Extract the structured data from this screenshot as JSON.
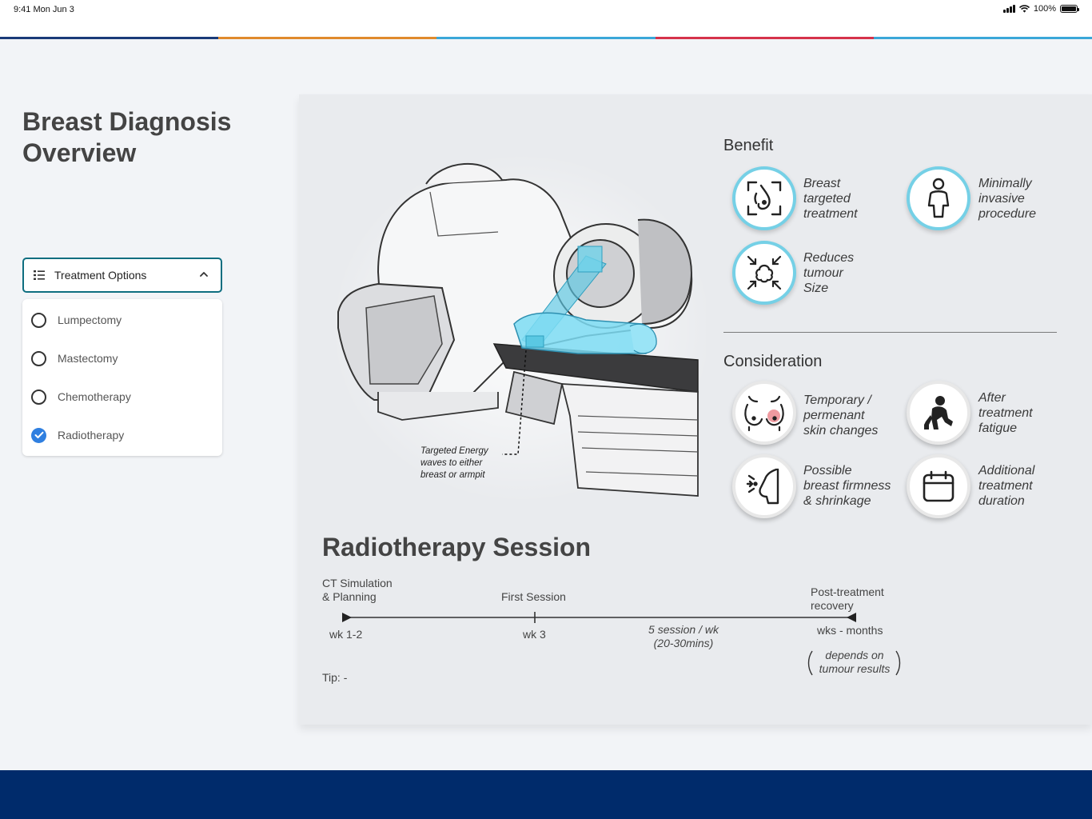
{
  "status_bar": {
    "time": "9:41  Mon Jun 3",
    "battery": "100%"
  },
  "colors": {
    "accent_bar": [
      "#1a3a78",
      "#e08a2c",
      "#3aa7d8",
      "#d6334b",
      "#3aa7d8"
    ],
    "footer": "#002b6b",
    "benefit_ring": "#75d0e6",
    "check": "#2f7fe0",
    "dropdown_border": "#0e6e80"
  },
  "page": {
    "title_line1": "Breast Diagnosis",
    "title_line2": "Overview"
  },
  "dropdown": {
    "label": "Treatment Options",
    "icon": "list-icon",
    "expanded": true
  },
  "options": [
    {
      "label": "Lumpectomy",
      "checked": false
    },
    {
      "label": "Mastectomy",
      "checked": false
    },
    {
      "label": "Chemotherapy",
      "checked": false
    },
    {
      "label": "Radiotherapy",
      "checked": true
    }
  ],
  "illustration": {
    "caption_line1": "Targeted Energy",
    "caption_line2": "waves to either",
    "caption_line3": "breast or armpit"
  },
  "benefit": {
    "title": "Benefit",
    "items": [
      {
        "icon": "breast-target-icon",
        "lines": [
          "Breast",
          "targeted",
          "treatment"
        ]
      },
      {
        "icon": "person-icon",
        "lines": [
          "Minimally",
          "invasive",
          "procedure"
        ]
      },
      {
        "icon": "shrink-tumour-icon",
        "lines": [
          "Reduces",
          "tumour",
          "Size"
        ]
      }
    ]
  },
  "consideration": {
    "title": "Consideration",
    "items": [
      {
        "icon": "skin-change-icon",
        "lines": [
          "Temporary /",
          "permenant",
          "skin changes"
        ]
      },
      {
        "icon": "fatigue-icon",
        "lines": [
          "After",
          "treatment",
          "fatigue"
        ]
      },
      {
        "icon": "breast-firmness-icon",
        "lines": [
          "Possible",
          "breast firmness",
          "& shrinkage"
        ]
      },
      {
        "icon": "calendar-icon",
        "lines": [
          "Additional",
          "treatment",
          "duration"
        ]
      }
    ]
  },
  "session": {
    "title": "Radiotherapy Session",
    "stage1_line1": "CT Simulation",
    "stage1_line2": "& Planning",
    "stage1_time": "wk 1-2",
    "stage2_label": "First Session",
    "stage2_time": "wk 3",
    "frequency_line1": "5 session / wk",
    "frequency_line2": "(20-30mins)",
    "stage3_line1": "Post-treatment",
    "stage3_line2": "recovery",
    "stage3_time": "wks - months",
    "note_line1": "depends on",
    "note_line2": "tumour results",
    "tip": "Tip: -"
  }
}
